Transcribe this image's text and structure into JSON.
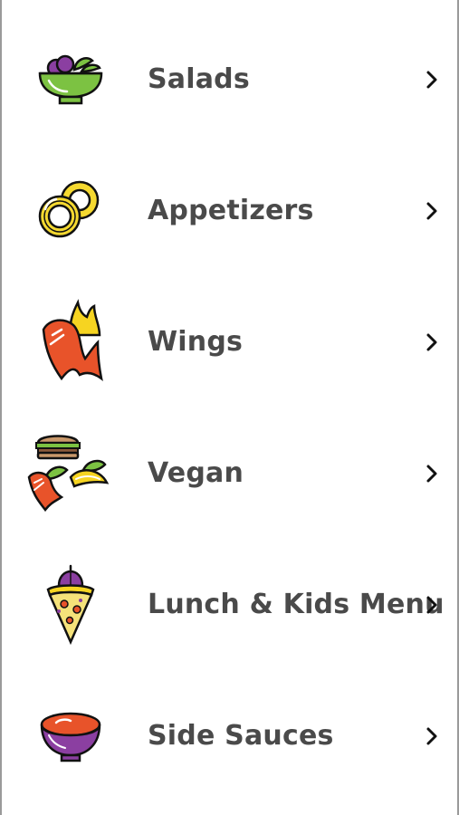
{
  "menu": {
    "items": [
      {
        "label": "Salads",
        "icon": "salad-bowl-icon"
      },
      {
        "label": "Appetizers",
        "icon": "onion-rings-icon"
      },
      {
        "label": "Wings",
        "icon": "spicy-wing-icon"
      },
      {
        "label": "Vegan",
        "icon": "vegan-food-icon"
      },
      {
        "label": "Lunch & Kids Menu",
        "icon": "pizza-slice-icon"
      },
      {
        "label": "Side Sauces",
        "icon": "sauce-bowl-icon"
      }
    ],
    "chevron_icon": "chevron-right-icon"
  },
  "colors": {
    "text": "#4a4a4a",
    "salad_green": "#7cc242",
    "onion_yellow": "#f5d930",
    "wing_red": "#e8532a",
    "flame_yellow": "#f6d421",
    "purple": "#8b3fa1"
  }
}
